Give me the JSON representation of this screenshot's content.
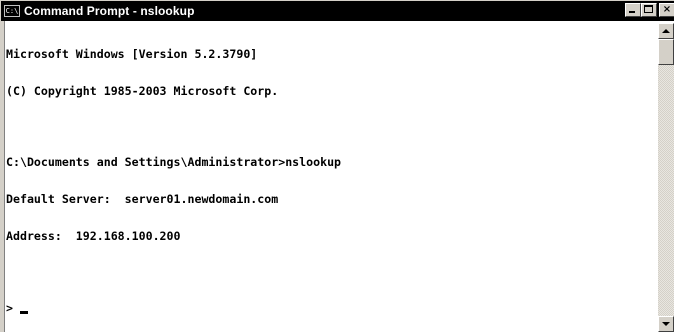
{
  "window": {
    "title": "Command Prompt - nslookup",
    "app_icon": "cmd-console-icon",
    "app_icon_glyph": "C:\\",
    "controls": {
      "minimize_icon": "minimize-icon",
      "maximize_icon": "maximize-icon",
      "close_icon": "close-icon",
      "close_glyph": "×"
    }
  },
  "colors": {
    "titlebar_bg": "#000000",
    "titlebar_text": "#ffffff",
    "console_bg": "#ffffff",
    "console_text": "#000000",
    "chrome": "#d4d0c8"
  },
  "console": {
    "lines": [
      "Microsoft Windows [Version 5.2.3790]",
      "(C) Copyright 1985-2003 Microsoft Corp.",
      "",
      "C:\\Documents and Settings\\Administrator>nslookup",
      "Default Server:  server01.newdomain.com",
      "Address:  192.168.100.200",
      ""
    ],
    "prompt": ">"
  },
  "scrollbar": {
    "up_icon": "scroll-up-arrow-icon",
    "down_icon": "scroll-down-arrow-icon"
  }
}
